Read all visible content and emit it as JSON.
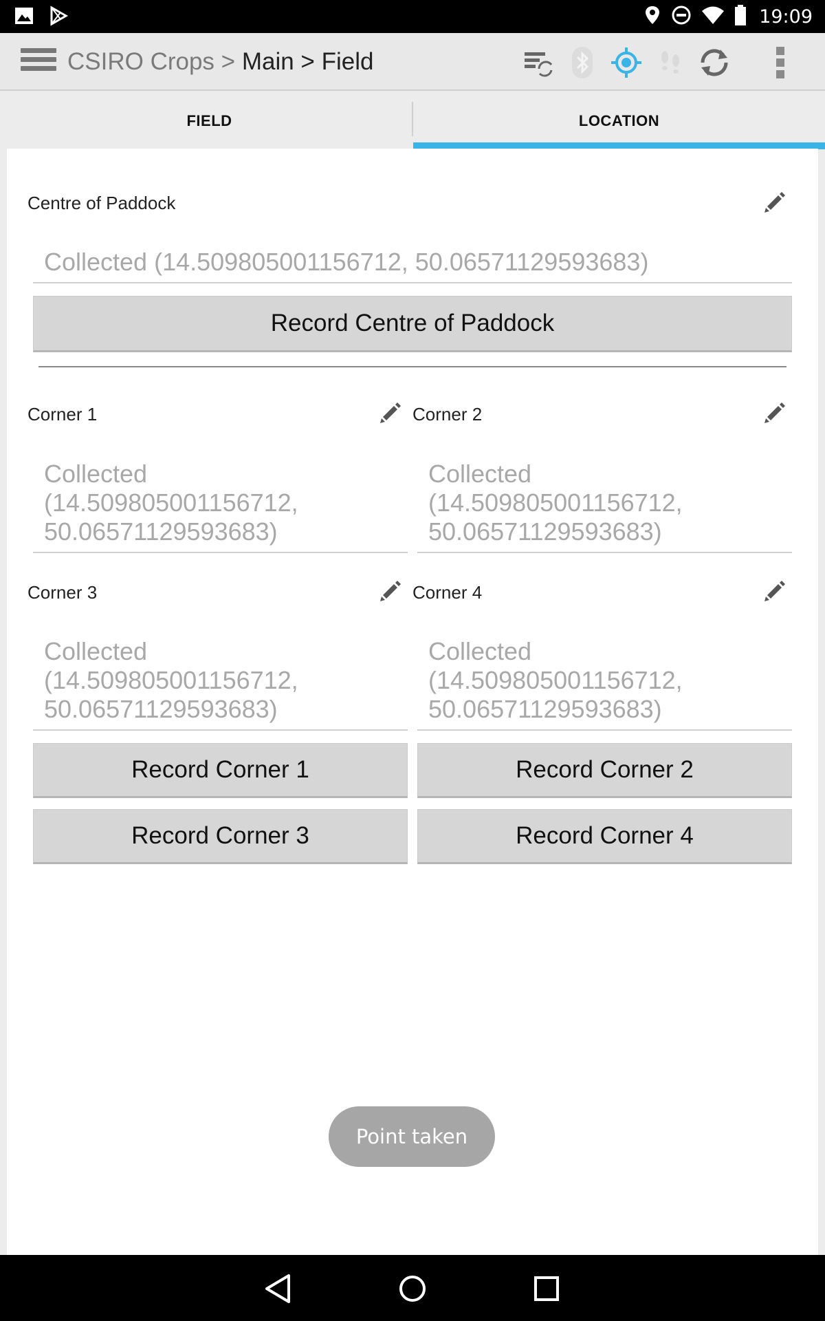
{
  "status_bar": {
    "time": "19:09",
    "icons": [
      "gallery-icon",
      "play-store-icon",
      "location-pin-icon",
      "do-not-disturb-icon",
      "wifi-icon",
      "battery-icon"
    ]
  },
  "action_bar": {
    "app": "CSIRO Crops",
    "sep1": " > ",
    "main": "Main",
    "sep2": " > ",
    "current": "Field",
    "icons": [
      "sync-data-icon",
      "bluetooth-icon",
      "gps-icon",
      "footsteps-icon",
      "refresh-icon",
      "overflow-menu-icon"
    ]
  },
  "tabs": [
    {
      "label": "FIELD"
    },
    {
      "label": "LOCATION",
      "selected": true
    }
  ],
  "location": {
    "centre": {
      "label": "Centre of Paddock",
      "value": "Collected (14.509805001156712, 50.06571129593683)",
      "button": "Record Centre of Paddock"
    },
    "corners": [
      {
        "label": "Corner 1",
        "value": "Collected (14.509805001156712, 50.06571129593683)",
        "button": "Record Corner 1"
      },
      {
        "label": "Corner 2",
        "value": "Collected (14.509805001156712, 50.06571129593683)",
        "button": "Record Corner 2"
      },
      {
        "label": "Corner 3",
        "value": "Collected (14.509805001156712, 50.06571129593683)",
        "button": "Record Corner 3"
      },
      {
        "label": "Corner 4",
        "value": "Collected (14.509805001156712, 50.06571129593683)",
        "button": "Record Corner 4"
      }
    ]
  },
  "toast": "Point taken",
  "colors": {
    "accent": "#3ab3e6",
    "gps_active": "#3ab3e6"
  }
}
